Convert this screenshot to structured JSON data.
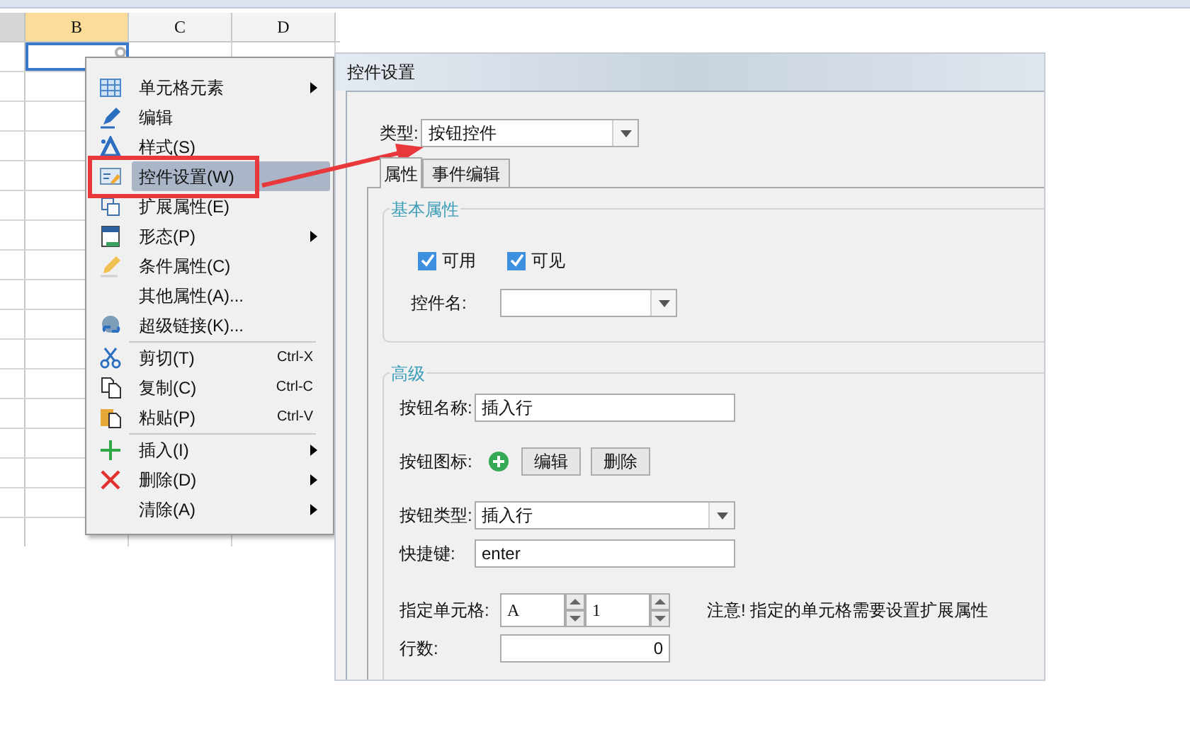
{
  "sheet": {
    "columns": [
      {
        "label": "B",
        "selected": true
      },
      {
        "label": "C",
        "selected": false
      },
      {
        "label": "D",
        "selected": false
      }
    ]
  },
  "context_menu": {
    "groups": [
      [
        {
          "label": "单元格元素",
          "submenu": true,
          "selected": false
        },
        {
          "label": "编辑",
          "submenu": false,
          "selected": false
        },
        {
          "label": "样式(S)",
          "submenu": false,
          "selected": false
        },
        {
          "label": "控件设置(W)",
          "submenu": false,
          "selected": true
        },
        {
          "label": "扩展属性(E)",
          "submenu": false,
          "selected": false
        },
        {
          "label": "形态(P)",
          "submenu": true,
          "selected": false
        },
        {
          "label": "条件属性(C)",
          "submenu": false,
          "selected": false
        },
        {
          "label": "其他属性(A)...",
          "submenu": false,
          "selected": false
        },
        {
          "label": "超级链接(K)...",
          "submenu": false,
          "selected": false
        }
      ],
      [
        {
          "label": "剪切(T)",
          "shortcut": "Ctrl-X",
          "submenu": false,
          "selected": false
        },
        {
          "label": "复制(C)",
          "shortcut": "Ctrl-C",
          "submenu": false,
          "selected": false
        },
        {
          "label": "粘贴(P)",
          "shortcut": "Ctrl-V",
          "submenu": false,
          "selected": false
        }
      ],
      [
        {
          "label": "插入(I)",
          "submenu": true,
          "selected": false
        },
        {
          "label": "删除(D)",
          "submenu": true,
          "selected": false
        },
        {
          "label": "清除(A)",
          "submenu": true,
          "selected": false
        }
      ]
    ]
  },
  "dialog": {
    "title": "控件设置",
    "type_field": {
      "label": "类型:",
      "value": "按钮控件"
    },
    "tabs": [
      {
        "label": "属性",
        "selected": true
      },
      {
        "label": "事件编辑",
        "selected": false
      }
    ],
    "basic": {
      "title": "基本属性",
      "checkboxes": [
        {
          "label": "可用",
          "checked": true
        },
        {
          "label": "可见",
          "checked": true
        }
      ],
      "control_name": {
        "label": "控件名:"
      }
    },
    "advanced": {
      "title": "高级",
      "button_name": {
        "label": "按钮名称:",
        "value": "插入行"
      },
      "button_icon": {
        "label": "按钮图标:",
        "buttons": [
          "编辑",
          "删除"
        ]
      },
      "button_type": {
        "label": "按钮类型:",
        "value": "插入行"
      },
      "shortcut": {
        "label": "快捷键:",
        "value": "enter"
      },
      "cell": {
        "label": "指定单元格:",
        "column": "A",
        "row": "1",
        "note": "注意! 指定的单元格需要设置扩展属性"
      },
      "row_count": {
        "label": "行数:",
        "value": "0"
      }
    }
  }
}
